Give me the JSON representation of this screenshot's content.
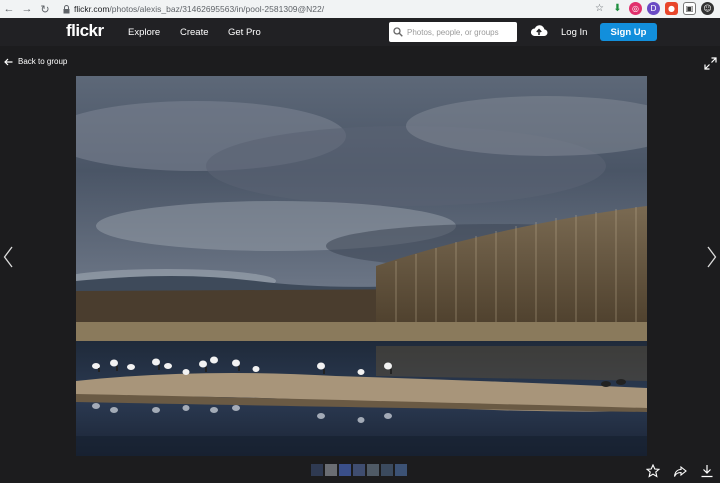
{
  "browser": {
    "url_host": "flickr.com",
    "url_path": "/photos/alexis_baz/31462695563/in/pool-2581309@N22/"
  },
  "header": {
    "logo": "flickr",
    "nav": [
      "Explore",
      "Create",
      "Get Pro"
    ],
    "search_placeholder": "Photos, people, or groups",
    "login": "Log In",
    "signup": "Sign Up",
    "accent_color": "#128fdc"
  },
  "viewer": {
    "back_label": "Back to group"
  },
  "filmstrip_colors": [
    "#2f3a52",
    "#6a6d73",
    "#3a4f8a",
    "#3f4d70",
    "#4f5a66",
    "#3b4a5e",
    "#3c5275"
  ]
}
